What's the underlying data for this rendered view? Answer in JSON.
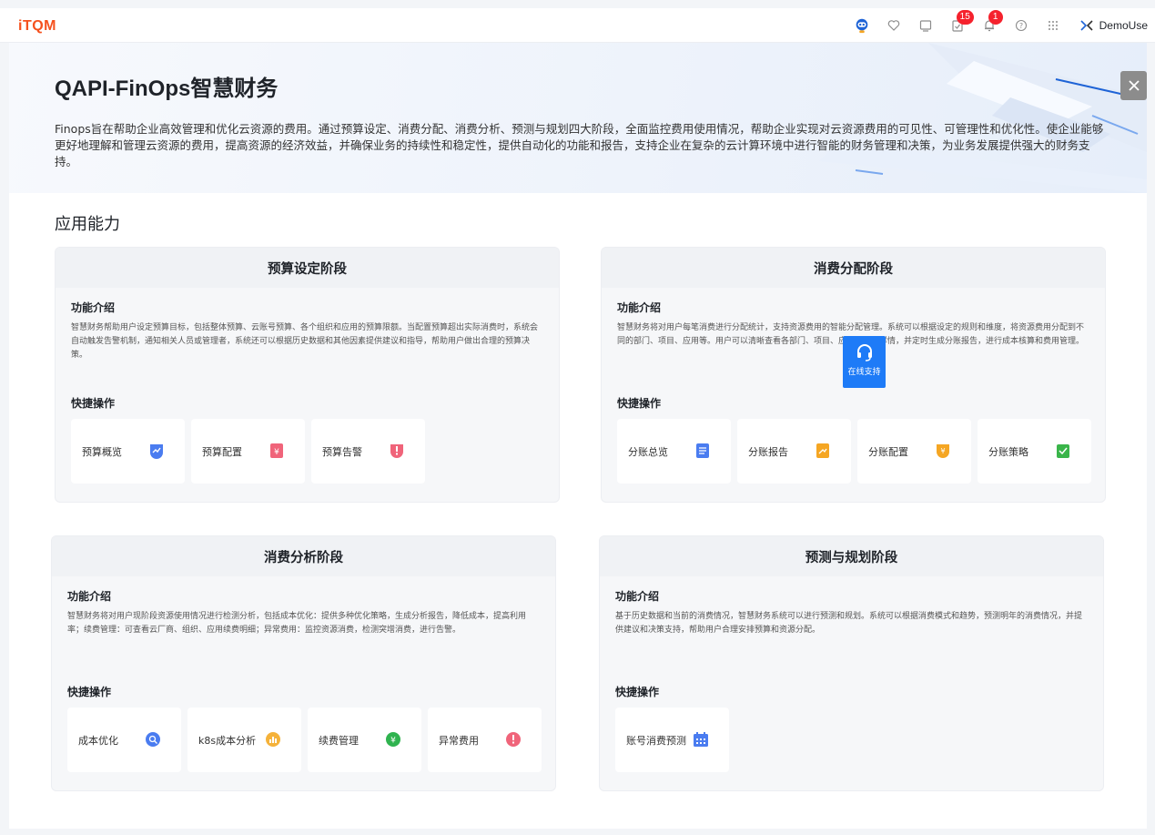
{
  "header": {
    "logo": "iTQM",
    "notifications_badge": "15",
    "alerts_badge": "1",
    "username": "DemoUse"
  },
  "hero": {
    "title": "QAPI-FinOps智慧财务",
    "description": "Finops旨在帮助企业高效管理和优化云资源的费用。通过预算设定、消费分配、消费分析、预测与规划四大阶段，全面监控费用使用情况，帮助企业实现对云资源费用的可见性、可管理性和优化性。使企业能够更好地理解和管理云资源的费用，提高资源的经济效益，并确保业务的持续性和稳定性，提供自动化的功能和报告，支持企业在复杂的云计算环境中进行智能的财务管理和决策，为业务发展提供强大的财务支持。"
  },
  "section": {
    "title": "应用能力"
  },
  "cards": [
    {
      "title": "预算设定阶段",
      "intro_label": "功能介绍",
      "intro": "智慧财务帮助用户设定预算目标，包括整体预算、云账号预算、各个组织和应用的预算限额。当配置预算超出实际消费时，系统会自动触发告警机制，通知相关人员或管理者，系统还可以根据历史数据和其他因素提供建议和指导，帮助用户做出合理的预算决策。",
      "ops_label": "快捷操作",
      "ops": [
        {
          "label": "预算概览",
          "icon": "budget-overview-icon",
          "color": "#4a7cf0"
        },
        {
          "label": "预算配置",
          "icon": "budget-config-icon",
          "color": "#f0647a"
        },
        {
          "label": "预算告警",
          "icon": "budget-alert-icon",
          "color": "#f0647a"
        }
      ]
    },
    {
      "title": "消费分配阶段",
      "intro_label": "功能介绍",
      "intro": "智慧财务将对用户每笔消费进行分配统计，支持资源费用的智能分配管理。系统可以根据设定的规则和维度，将资源费用分配到不同的部门、项目、应用等。用户可以清晰查看各部门、项目、应用的消费详情，并定时生成分账报告，进行成本核算和费用管理。",
      "ops_label": "快捷操作",
      "ops": [
        {
          "label": "分账总览",
          "icon": "split-overview-icon",
          "color": "#4a7cf0"
        },
        {
          "label": "分账报告",
          "icon": "split-report-icon",
          "color": "#f5a623"
        },
        {
          "label": "分账配置",
          "icon": "split-config-icon",
          "color": "#f5a623"
        },
        {
          "label": "分账策略",
          "icon": "split-strategy-icon",
          "color": "#3ab54a"
        }
      ]
    },
    {
      "title": "消费分析阶段",
      "intro_label": "功能介绍",
      "intro": "智慧财务将对用户现阶段资源使用情况进行检测分析，包括成本优化：提供多种优化策略，生成分析报告，降低成本，提高利用率；续费管理：可查看云厂商、组织、应用续费明细；异常费用：监控资源消费，检测突增消费，进行告警。",
      "ops_label": "快捷操作",
      "ops": [
        {
          "label": "成本优化",
          "icon": "cost-optimize-icon",
          "color": "#4a7cf0"
        },
        {
          "label": "k8s成本分析",
          "icon": "k8s-cost-icon",
          "color": "#f5b23a"
        },
        {
          "label": "续费管理",
          "icon": "renewal-icon",
          "color": "#2fb34f"
        },
        {
          "label": "异常费用",
          "icon": "abnormal-cost-icon",
          "color": "#f0647a"
        }
      ]
    },
    {
      "title": "预测与规划阶段",
      "intro_label": "功能介绍",
      "intro": "基于历史数据和当前的消费情况，智慧财务系统可以进行预测和规划。系统可以根据消费模式和趋势，预测明年的消费情况，并提供建议和决策支持，帮助用户合理安排预算和资源分配。",
      "ops_label": "快捷操作",
      "ops": [
        {
          "label": "账号消费预测",
          "icon": "forecast-calendar-icon",
          "color": "#4a7cf0"
        }
      ]
    }
  ],
  "support": {
    "label": "在线支持"
  }
}
